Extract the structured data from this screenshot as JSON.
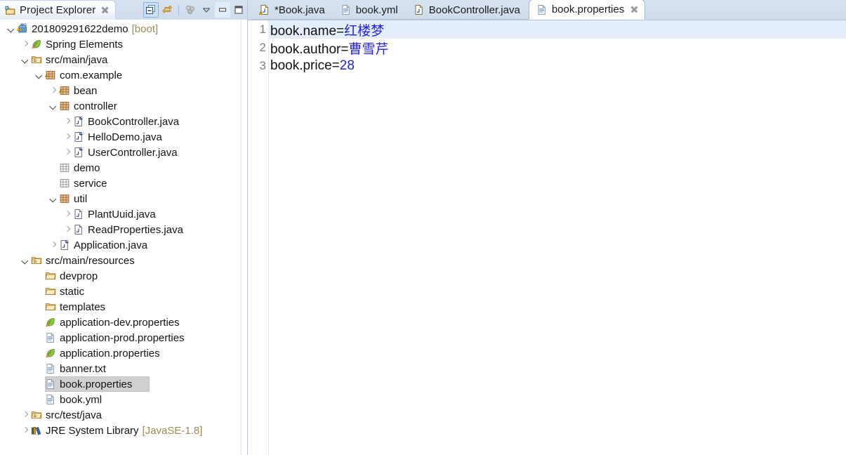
{
  "explorer": {
    "tab": {
      "label": "Project Explorer",
      "icon": "project-explorer-icon",
      "close_icon": "close-icon"
    },
    "toolbar": [
      {
        "name": "collapse-all-button",
        "icon": "collapse-all-icon",
        "state": "pressed"
      },
      {
        "name": "link-with-editor-button",
        "icon": "link-editor-icon",
        "state": "normal"
      },
      {
        "name": "toolbar-separator",
        "icon": "separator",
        "state": "static"
      },
      {
        "name": "view-menu-button",
        "icon": "filters-icon",
        "state": "normal"
      },
      {
        "name": "view-dropdown-button",
        "icon": "chevron-down-icon",
        "state": "normal"
      },
      {
        "name": "minimize-view-button",
        "icon": "minimize-icon",
        "state": "soft"
      },
      {
        "name": "maximize-view-button",
        "icon": "maximize-icon",
        "state": "normal"
      }
    ],
    "tree": [
      {
        "depth": 0,
        "arrow": "down",
        "icon": "spring-boot-project-icon",
        "label": "201809291622demo",
        "suffix": "[boot]",
        "selected": false
      },
      {
        "depth": 1,
        "arrow": "right",
        "icon": "spring-leaf-icon",
        "label": "Spring Elements",
        "suffix": "",
        "selected": false
      },
      {
        "depth": 1,
        "arrow": "down",
        "icon": "source-folder-icon",
        "label": "src/main/java",
        "suffix": "",
        "selected": false
      },
      {
        "depth": 2,
        "arrow": "down",
        "icon": "package-spring-icon",
        "label": "com.example",
        "suffix": "",
        "selected": false
      },
      {
        "depth": 3,
        "arrow": "right",
        "icon": "package-spring-icon",
        "label": "bean",
        "suffix": "",
        "selected": false
      },
      {
        "depth": 3,
        "arrow": "down",
        "icon": "package-icon",
        "label": "controller",
        "suffix": "",
        "selected": false
      },
      {
        "depth": 4,
        "arrow": "right",
        "icon": "java-class-spring-icon",
        "label": "BookController.java",
        "suffix": "",
        "selected": false
      },
      {
        "depth": 4,
        "arrow": "right",
        "icon": "java-class-spring-icon",
        "label": "HelloDemo.java",
        "suffix": "",
        "selected": false
      },
      {
        "depth": 4,
        "arrow": "right",
        "icon": "java-class-spring-icon",
        "label": "UserController.java",
        "suffix": "",
        "selected": false
      },
      {
        "depth": 3,
        "arrow": "none",
        "icon": "package-empty-icon",
        "label": "demo",
        "suffix": "",
        "selected": false
      },
      {
        "depth": 3,
        "arrow": "none",
        "icon": "package-empty-icon",
        "label": "service",
        "suffix": "",
        "selected": false
      },
      {
        "depth": 3,
        "arrow": "down",
        "icon": "package-icon",
        "label": "util",
        "suffix": "",
        "selected": false
      },
      {
        "depth": 4,
        "arrow": "right",
        "icon": "java-class-icon",
        "label": "PlantUuid.java",
        "suffix": "",
        "selected": false
      },
      {
        "depth": 4,
        "arrow": "right",
        "icon": "java-class-icon",
        "label": "ReadProperties.java",
        "suffix": "",
        "selected": false
      },
      {
        "depth": 3,
        "arrow": "right",
        "icon": "java-class-spring-icon",
        "label": "Application.java",
        "suffix": "",
        "selected": false
      },
      {
        "depth": 1,
        "arrow": "down",
        "icon": "source-folder-icon",
        "label": "src/main/resources",
        "suffix": "",
        "selected": false
      },
      {
        "depth": 2,
        "arrow": "none",
        "icon": "folder-icon",
        "label": "devprop",
        "suffix": "",
        "selected": false
      },
      {
        "depth": 2,
        "arrow": "none",
        "icon": "folder-icon",
        "label": "static",
        "suffix": "",
        "selected": false
      },
      {
        "depth": 2,
        "arrow": "none",
        "icon": "folder-icon",
        "label": "templates",
        "suffix": "",
        "selected": false
      },
      {
        "depth": 2,
        "arrow": "none",
        "icon": "spring-leaf-icon",
        "label": "application-dev.properties",
        "suffix": "",
        "selected": false
      },
      {
        "depth": 2,
        "arrow": "none",
        "icon": "file-icon",
        "label": "application-prod.properties",
        "suffix": "",
        "selected": false
      },
      {
        "depth": 2,
        "arrow": "none",
        "icon": "spring-leaf-icon",
        "label": "application.properties",
        "suffix": "",
        "selected": false
      },
      {
        "depth": 2,
        "arrow": "none",
        "icon": "file-icon",
        "label": "banner.txt",
        "suffix": "",
        "selected": false
      },
      {
        "depth": 2,
        "arrow": "none",
        "icon": "file-icon",
        "label": "book.properties",
        "suffix": "",
        "selected": true
      },
      {
        "depth": 2,
        "arrow": "none",
        "icon": "file-icon",
        "label": "book.yml",
        "suffix": "",
        "selected": false
      },
      {
        "depth": 1,
        "arrow": "right",
        "icon": "source-folder-icon",
        "label": "src/test/java",
        "suffix": "",
        "selected": false
      },
      {
        "depth": 1,
        "arrow": "right",
        "icon": "library-icon",
        "label": "JRE System Library",
        "suffix": "[JavaSE-1.8]",
        "selected": false
      }
    ]
  },
  "editor": {
    "tabs": [
      {
        "label": "*Book.java",
        "icon": "java-file-dirty-icon",
        "active": false,
        "closable": false
      },
      {
        "label": "book.yml",
        "icon": "file-icon",
        "active": false,
        "closable": false
      },
      {
        "label": "BookController.java",
        "icon": "java-file-icon",
        "active": false,
        "closable": false
      },
      {
        "label": "book.properties",
        "icon": "file-icon",
        "active": true,
        "closable": true
      }
    ],
    "close_icon": "close-icon",
    "lines": [
      {
        "num": "1",
        "key": "book.name",
        "eq": "=",
        "value": "红楼梦",
        "current": true
      },
      {
        "num": "2",
        "key": "book.author",
        "eq": "=",
        "value": "曹雪芹",
        "current": false
      },
      {
        "num": "3",
        "key": "book.price",
        "eq": "=",
        "value": "28",
        "current": false
      }
    ]
  },
  "colors": {
    "tab_bar": "#d3dfee",
    "current_line": "#e4eefb",
    "value_text": "#2222dd",
    "selection": "#d0d0d0",
    "suffix_text": "#9b8b57",
    "active_tab_border": "#9dbbdc"
  }
}
